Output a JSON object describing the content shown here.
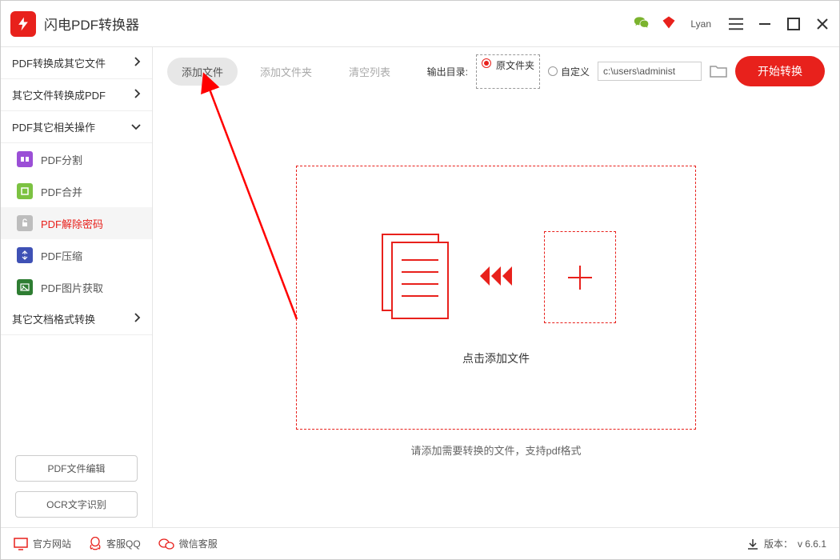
{
  "app": {
    "title": "闪电PDF转换器",
    "user": "Lyan"
  },
  "sidebar": {
    "groups": [
      {
        "label": "PDF转换成其它文件"
      },
      {
        "label": "其它文件转换成PDF"
      },
      {
        "label": "PDF其它相关操作"
      },
      {
        "label": "其它文档格式转换"
      }
    ],
    "subs": [
      {
        "label": "PDF分割",
        "color": "#9b4fd6"
      },
      {
        "label": "PDF合并",
        "color": "#7cc242"
      },
      {
        "label": "PDF解除密码",
        "color": "#bdbdbd"
      },
      {
        "label": "PDF压缩",
        "color": "#3f51b5"
      },
      {
        "label": "PDF图片获取",
        "color": "#2e7d32"
      }
    ],
    "bottom": {
      "edit": "PDF文件编辑",
      "ocr": "OCR文字识别"
    }
  },
  "toolbar": {
    "add_file": "添加文件",
    "add_folder": "添加文件夹",
    "clear_list": "清空列表",
    "output_label": "输出目录:",
    "radio_source": "原文件夹",
    "radio_custom": "自定义",
    "path_value": "c:\\users\\administ",
    "start": "开始转换"
  },
  "drop": {
    "click_text": "点击添加文件",
    "hint_text": "请添加需要转换的文件，支持pdf格式"
  },
  "footer": {
    "website": "官方网站",
    "qq": "客服QQ",
    "wechat": "微信客服",
    "version_label": "版本：",
    "version": "v 6.6.1"
  }
}
